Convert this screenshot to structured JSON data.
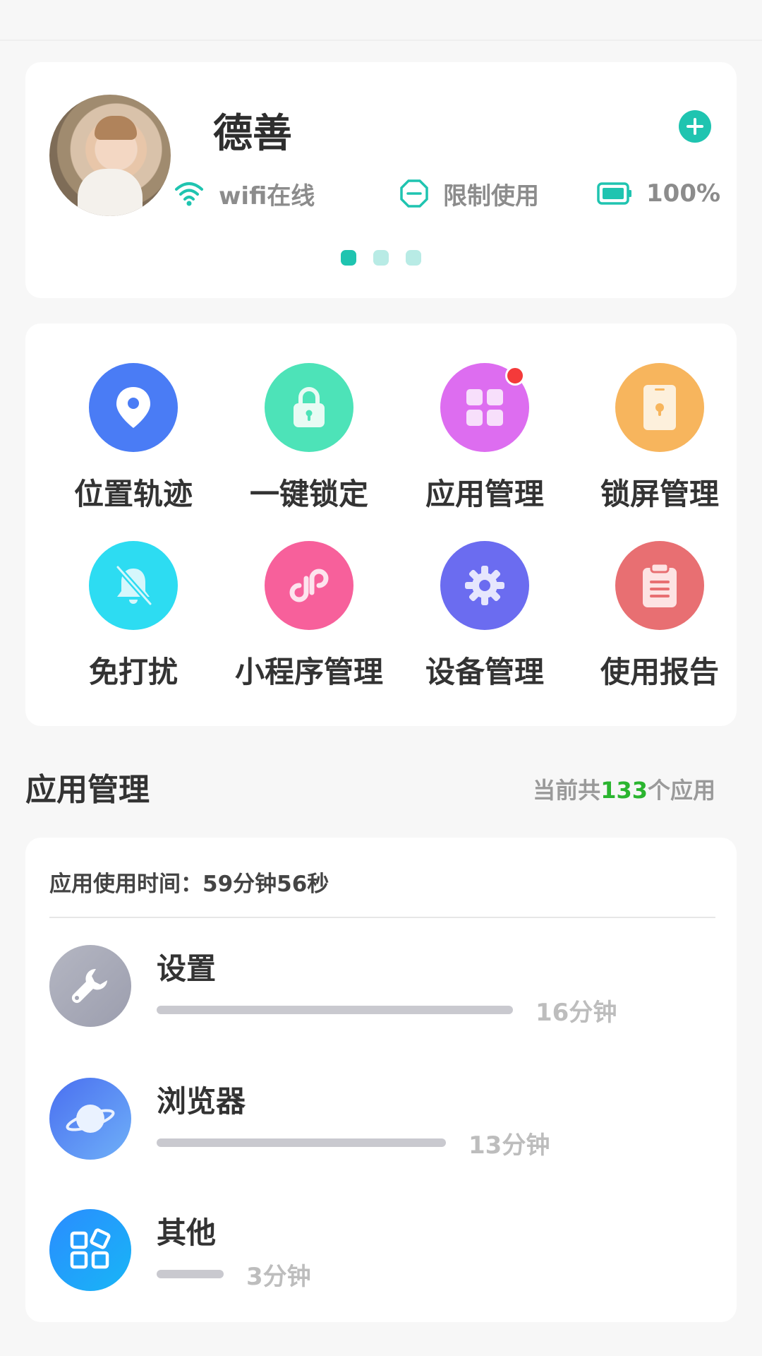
{
  "profile": {
    "name": "德善",
    "avatar": "child-avatar-photo",
    "status": {
      "wifi": "wifi在线",
      "limit": "限制使用",
      "battery": "100%"
    },
    "page_dots": {
      "count": 3,
      "active_index": 0
    }
  },
  "features": [
    {
      "label": "位置轨迹",
      "icon": "location-pin-icon",
      "color": "#4a7cf5"
    },
    {
      "label": "一键锁定",
      "icon": "lock-icon",
      "color": "#4de3b8"
    },
    {
      "label": "应用管理",
      "icon": "apps-grid-icon",
      "color": "#dd6df0",
      "badge": true
    },
    {
      "label": "锁屏管理",
      "icon": "phone-lock-icon",
      "color": "#f7b55d"
    },
    {
      "label": "免打扰",
      "icon": "bell-off-icon",
      "color": "#2ddcf2"
    },
    {
      "label": "小程序管理",
      "icon": "mini-program-icon",
      "color": "#f7609b"
    },
    {
      "label": "设备管理",
      "icon": "gear-icon",
      "color": "#6b6cf0"
    },
    {
      "label": "使用报告",
      "icon": "clipboard-icon",
      "color": "#e86f72"
    }
  ],
  "app_section": {
    "title": "应用管理",
    "count_prefix": "当前共",
    "count": "133",
    "count_suffix": "个应用",
    "count_color": "#2bb530"
  },
  "usage": {
    "total_label": "应用使用时间：59分钟56秒",
    "apps": [
      {
        "name": "设置",
        "time": "16分钟",
        "minutes": 16,
        "icon": "wrench-icon"
      },
      {
        "name": "浏览器",
        "time": "13分钟",
        "minutes": 13,
        "icon": "planet-icon"
      },
      {
        "name": "其他",
        "time": "3分钟",
        "minutes": 3,
        "icon": "apps-other-icon"
      }
    ]
  },
  "colors": {
    "accent": "#1fc4b0",
    "badge": "#f43a3a"
  }
}
